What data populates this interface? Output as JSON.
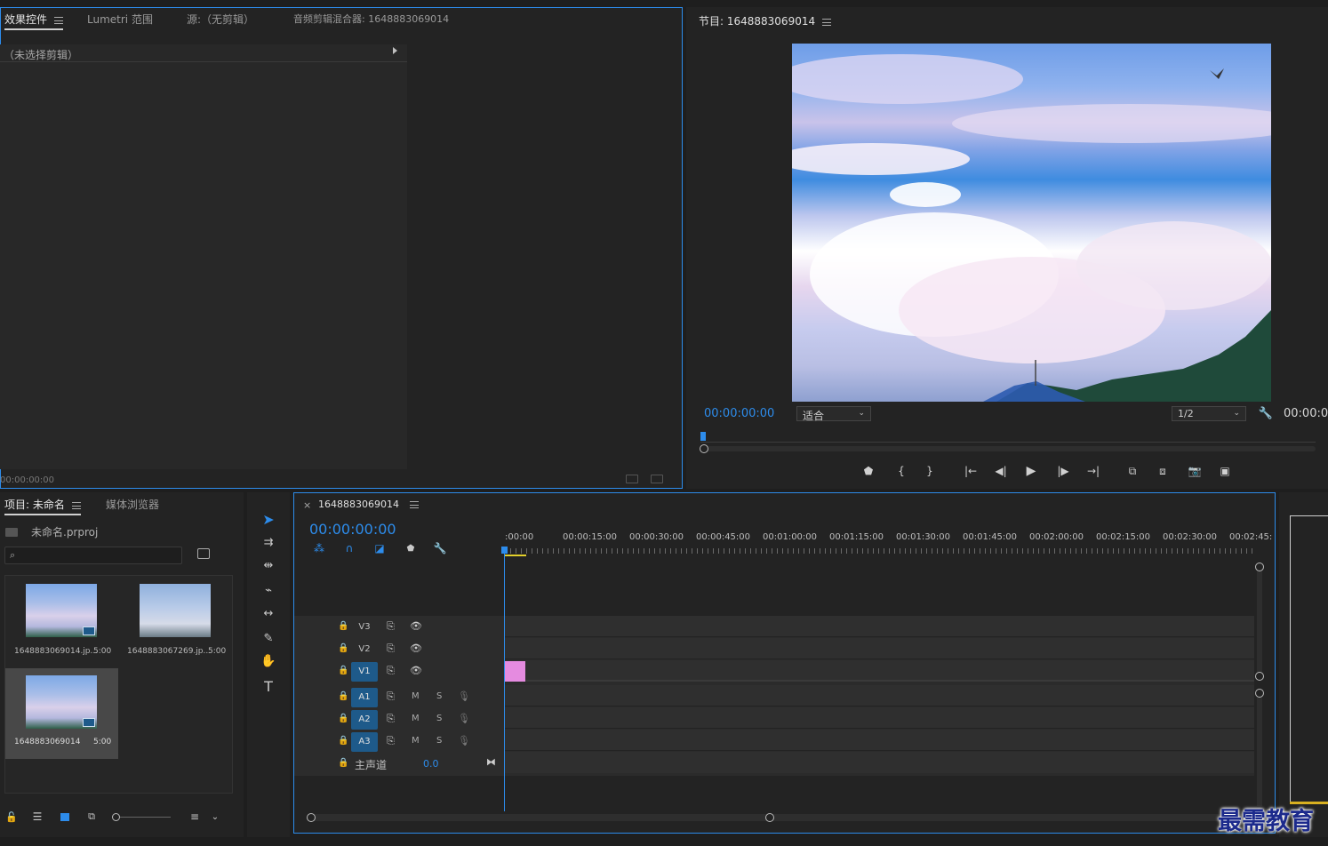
{
  "effects_panel": {
    "tabs": [
      {
        "label": "效果控件",
        "active": true
      },
      {
        "label": "Lumetri 范围",
        "active": false
      },
      {
        "label": "源:（无剪辑）",
        "active": false
      },
      {
        "label": "音频剪辑混合器: 1648883069014",
        "active": false
      }
    ],
    "no_clip_label": "（未选择剪辑）",
    "timecode": "00:00:00:00"
  },
  "program_monitor": {
    "title": "节目: 1648883069014",
    "timecode": "00:00:00:00",
    "fit_option": "适合",
    "resolution": "1/2",
    "duration_partial": "00:00:0"
  },
  "project_panel": {
    "tabs": [
      {
        "label": "项目: 未命名",
        "active": true
      },
      {
        "label": "媒体浏览器",
        "active": false
      }
    ],
    "project_file": "未命名.prproj",
    "search_placeholder": "",
    "items": [
      {
        "name": "1648883069014.jp...",
        "duration": "5:00",
        "selected": false,
        "kind": "sequence-badge"
      },
      {
        "name": "1648883067269.jp...",
        "duration": "5:00",
        "selected": false,
        "kind": "image"
      },
      {
        "name": "1648883069014",
        "duration": "5:00",
        "selected": true,
        "kind": "sequence"
      }
    ]
  },
  "timeline": {
    "sequence_name": "1648883069014",
    "close_label": "×",
    "timecode": "00:00:00:00",
    "ruler_labels": [
      ":00:00",
      "00:00:15:00",
      "00:00:30:00",
      "00:00:45:00",
      "00:01:00:00",
      "00:01:15:00",
      "00:01:30:00",
      "00:01:45:00",
      "00:02:00:00",
      "00:02:15:00",
      "00:02:30:00",
      "00:02:45:"
    ],
    "video_tracks": [
      {
        "name": "V3",
        "targeted": false
      },
      {
        "name": "V2",
        "targeted": false
      },
      {
        "name": "V1",
        "targeted": true
      }
    ],
    "audio_tracks": [
      {
        "name": "A1",
        "targeted": true,
        "m": "M",
        "s": "S"
      },
      {
        "name": "A2",
        "targeted": true,
        "m": "M",
        "s": "S"
      },
      {
        "name": "A3",
        "targeted": true,
        "m": "M",
        "s": "S"
      }
    ],
    "master": {
      "label": "主声道",
      "value": "0.0"
    },
    "clip_color": "#e58be0"
  },
  "watermark": "最需教育",
  "colors": {
    "accent": "#2d8ceb",
    "panel": "#232323",
    "clip": "#e58be0"
  }
}
